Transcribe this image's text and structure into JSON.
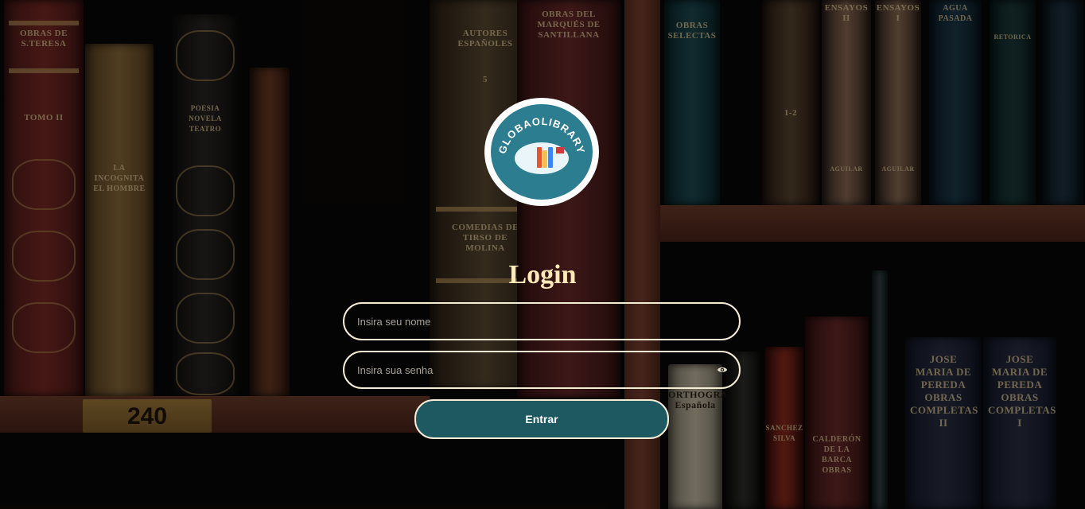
{
  "brand": {
    "name": "GLOBAOLIBRARY"
  },
  "background": {
    "shelf_label": "240",
    "spines": [
      "OBRAS DE S.TERESA",
      "TOMO II",
      "LA INCOGNITA EL HOMBRE",
      "POESIA NOVELA TEATRO",
      "AUTORES ESPAÑOLES",
      "5",
      "COMEDIAS DE TIRSO DE MOLINA",
      "OBRAS DEL MARQUÉS DE SANTILLANA",
      "OBRAS SELECTAS",
      "1-2",
      "ENSAYOS II",
      "ENSAYOS I",
      "AGUILAR",
      "AGUILAR",
      "AGUA PASADA",
      "RETORICA",
      "ORTHOGRAPHIA Española",
      "SANCHEZ SILVA",
      "CALDERÓN DE LA BARCA OBRAS",
      "JOSE MARIA DE PEREDA OBRAS COMPLETAS II",
      "JOSE MARIA DE PEREDA OBRAS COMPLETAS I"
    ]
  },
  "login": {
    "title": "Login",
    "name_placeholder": "Insira seu nome",
    "password_placeholder": "Insira sua senha",
    "submit_label": "Entrar"
  },
  "colors": {
    "title": "#fbe9b7",
    "border": "#f5ecd6",
    "button": "#1e5962",
    "logo": "#2c7d90"
  },
  "icons": {
    "password_toggle": "eye-icon",
    "logo": "globaolibrary-logo"
  }
}
